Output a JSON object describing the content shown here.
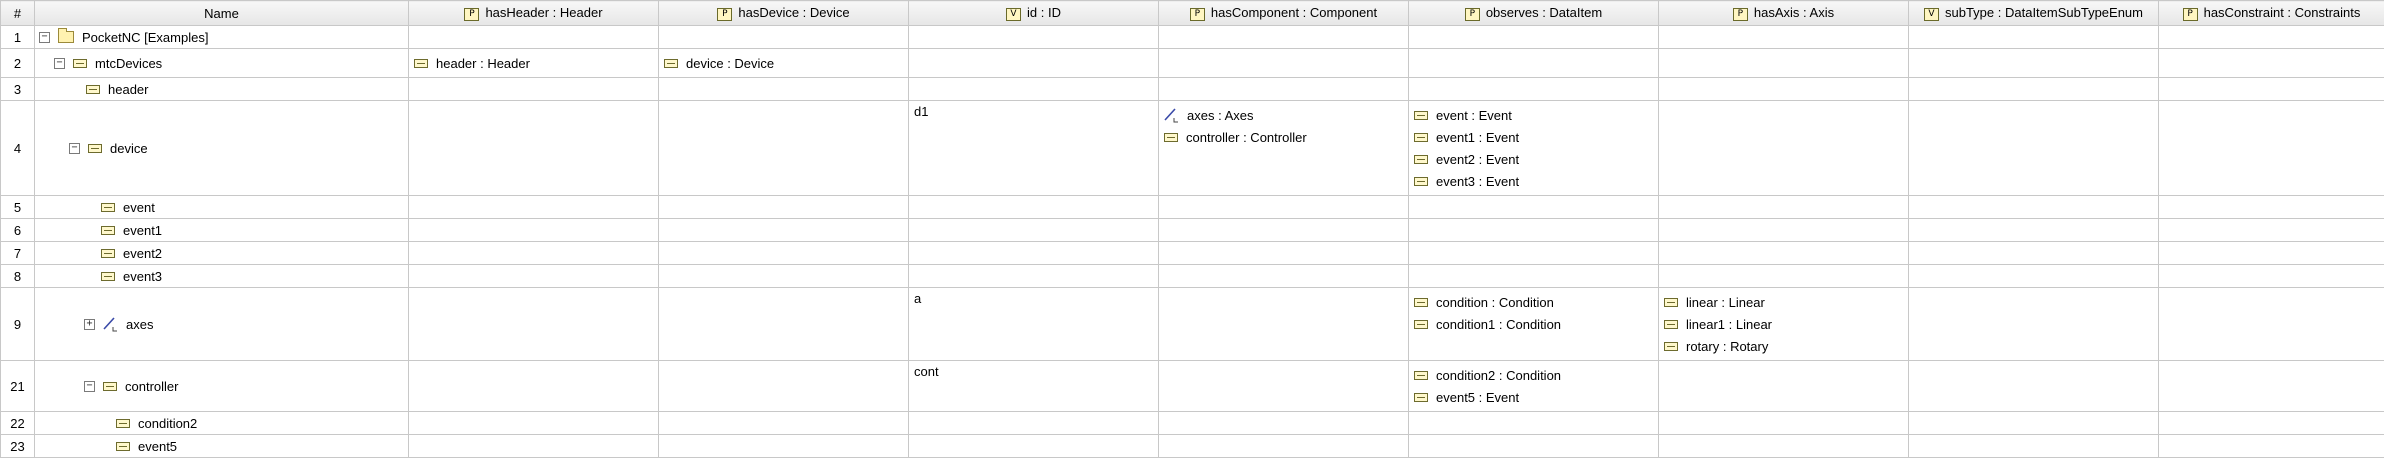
{
  "headers": [
    {
      "label": "#",
      "chip": ""
    },
    {
      "label": "Name",
      "chip": ""
    },
    {
      "label": "hasHeader : Header",
      "chip": "P"
    },
    {
      "label": "hasDevice : Device",
      "chip": "P"
    },
    {
      "label": "id : ID",
      "chip": "V"
    },
    {
      "label": "hasComponent : Component",
      "chip": "P"
    },
    {
      "label": "observes : DataItem",
      "chip": "P"
    },
    {
      "label": "hasAxis : Axis",
      "chip": "P"
    },
    {
      "label": "subType : DataItemSubTypeEnum",
      "chip": "V"
    },
    {
      "label": "hasConstraint : Constraints",
      "chip": "P"
    }
  ],
  "rows": [
    {
      "num": "1",
      "name": "PocketNC [Examples]",
      "icon": "folder-icon",
      "toggle": "−",
      "indent": 0,
      "height": 23,
      "hasHeader": [],
      "hasDevice": [],
      "id": "",
      "hasComponent": [],
      "observes": [],
      "hasAxis": []
    },
    {
      "num": "2",
      "name": "mtcDevices",
      "icon": "item-icon",
      "toggle": "−",
      "indent": 1,
      "height": 23,
      "hasHeader": [
        {
          "icon": "item-icon",
          "text": "header : Header"
        }
      ],
      "hasDevice": [
        {
          "icon": "item-icon",
          "text": "device : Device"
        }
      ],
      "id": "",
      "hasComponent": [],
      "observes": [],
      "hasAxis": []
    },
    {
      "num": "3",
      "name": "header",
      "icon": "item-icon",
      "toggle": "",
      "indent": 2,
      "height": 23,
      "hasHeader": [],
      "hasDevice": [],
      "id": "",
      "hasComponent": [],
      "observes": [],
      "hasAxis": []
    },
    {
      "num": "4",
      "name": "device",
      "icon": "item-icon",
      "toggle": "−",
      "indent": 2,
      "height": 90,
      "hasHeader": [],
      "hasDevice": [],
      "id": "d1",
      "hasComponent": [
        {
          "icon": "axes-icon",
          "text": "axes : Axes"
        },
        {
          "icon": "item-icon",
          "text": "controller : Controller"
        }
      ],
      "observes": [
        {
          "icon": "item-icon",
          "text": "event : Event"
        },
        {
          "icon": "item-icon",
          "text": "event1 : Event"
        },
        {
          "icon": "item-icon",
          "text": "event2 : Event"
        },
        {
          "icon": "item-icon",
          "text": "event3 : Event"
        }
      ],
      "hasAxis": []
    },
    {
      "num": "5",
      "name": "event",
      "icon": "item-icon",
      "toggle": "",
      "indent": 3,
      "height": 23,
      "hasHeader": [],
      "hasDevice": [],
      "id": "",
      "hasComponent": [],
      "observes": [],
      "hasAxis": []
    },
    {
      "num": "6",
      "name": "event1",
      "icon": "item-icon",
      "toggle": "",
      "indent": 3,
      "height": 23,
      "hasHeader": [],
      "hasDevice": [],
      "id": "",
      "hasComponent": [],
      "observes": [],
      "hasAxis": []
    },
    {
      "num": "7",
      "name": "event2",
      "icon": "item-icon",
      "toggle": "",
      "indent": 3,
      "height": 23,
      "hasHeader": [],
      "hasDevice": [],
      "id": "",
      "hasComponent": [],
      "observes": [],
      "hasAxis": []
    },
    {
      "num": "8",
      "name": "event3",
      "icon": "item-icon",
      "toggle": "",
      "indent": 3,
      "height": 23,
      "hasHeader": [],
      "hasDevice": [],
      "id": "",
      "hasComponent": [],
      "observes": [],
      "hasAxis": []
    },
    {
      "num": "9",
      "name": "axes",
      "icon": "axes-icon",
      "toggle": "+",
      "indent": 3,
      "height": 68,
      "hasHeader": [],
      "hasDevice": [],
      "id": "a",
      "hasComponent": [],
      "observes": [
        {
          "icon": "item-icon",
          "text": "condition : Condition"
        },
        {
          "icon": "item-icon",
          "text": "condition1 : Condition"
        }
      ],
      "hasAxis": [
        {
          "icon": "item-icon",
          "text": "linear : Linear"
        },
        {
          "icon": "item-icon",
          "text": "linear1 : Linear"
        },
        {
          "icon": "item-icon",
          "text": "rotary : Rotary"
        }
      ]
    },
    {
      "num": "21",
      "name": "controller",
      "icon": "item-icon",
      "toggle": "−",
      "indent": 3,
      "height": 46,
      "hasHeader": [],
      "hasDevice": [],
      "id": "cont",
      "hasComponent": [],
      "observes": [
        {
          "icon": "item-icon",
          "text": "condition2 : Condition"
        },
        {
          "icon": "item-icon",
          "text": "event5 : Event"
        }
      ],
      "hasAxis": []
    },
    {
      "num": "22",
      "name": "condition2",
      "icon": "item-icon",
      "toggle": "",
      "indent": 4,
      "height": 23,
      "hasHeader": [],
      "hasDevice": [],
      "id": "",
      "hasComponent": [],
      "observes": [],
      "hasAxis": []
    },
    {
      "num": "23",
      "name": "event5",
      "icon": "item-icon",
      "toggle": "",
      "indent": 4,
      "height": 23,
      "hasHeader": [],
      "hasDevice": [],
      "id": "",
      "hasComponent": [],
      "observes": [],
      "hasAxis": []
    }
  ]
}
